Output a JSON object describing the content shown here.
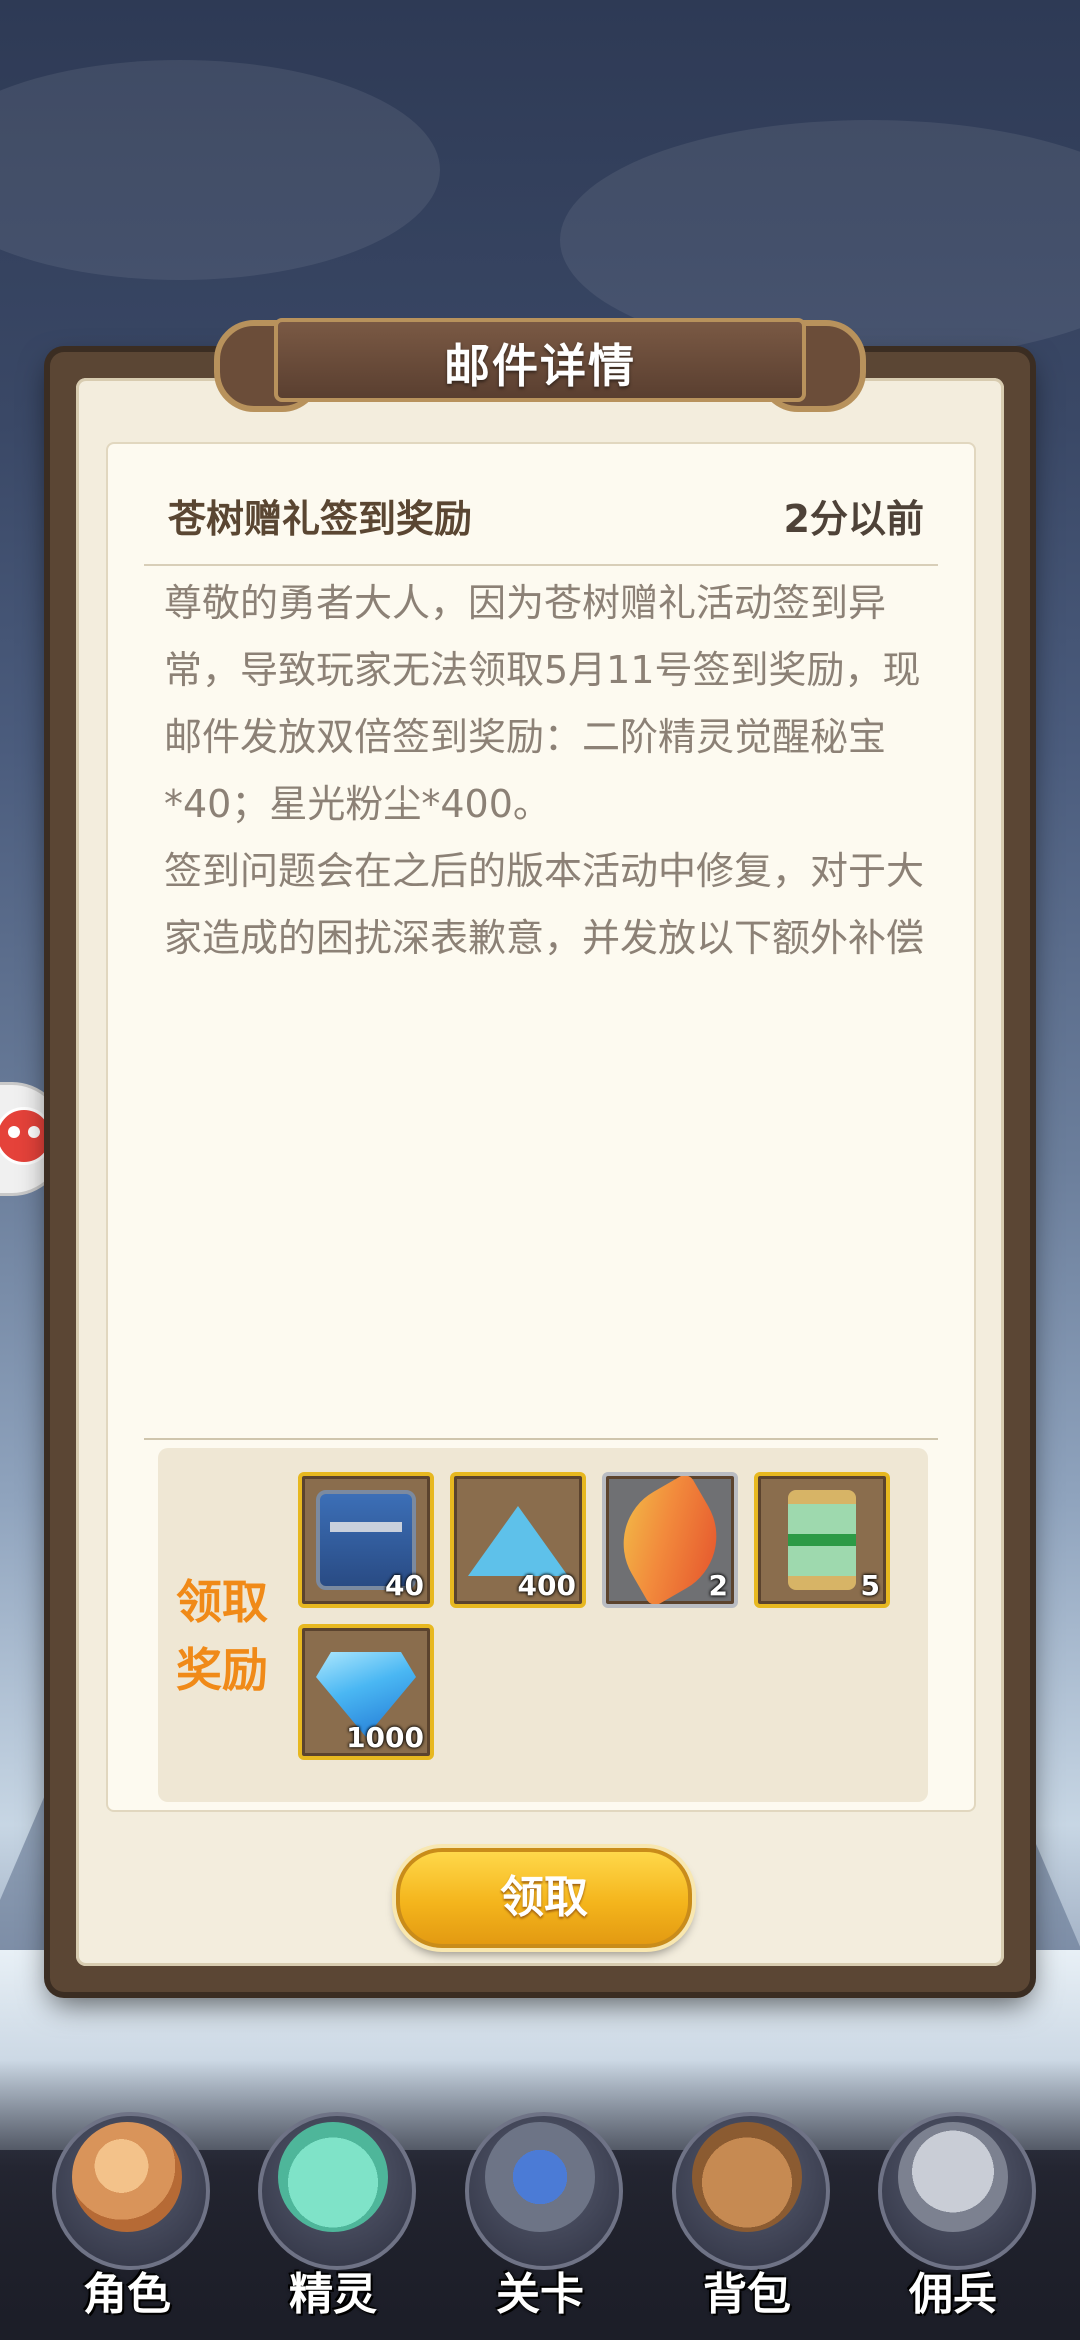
{
  "dialog": {
    "title": "邮件详情"
  },
  "mail": {
    "subject": "苍树赠礼签到奖励",
    "time": "2分以前",
    "body_paragraph_1": "尊敬的勇者大人，因为苍树赠礼活动签到异常，导致玩家无法领取5月11号签到奖励，现邮件发放双倍签到奖励：二阶精灵觉醒秘宝*40；星光粉尘*400。",
    "body_paragraph_2": "签到问题会在之后的版本活动中修复，对于大家造成的困扰深表歉意，并发放以下额外补偿"
  },
  "rewards": {
    "label": "领取奖励",
    "items": [
      {
        "icon": "treasure-chest-icon",
        "quantity": "40"
      },
      {
        "icon": "star-dust-icon",
        "quantity": "400"
      },
      {
        "icon": "feather-icon",
        "quantity": "2"
      },
      {
        "icon": "hourglass-icon",
        "quantity": "5"
      },
      {
        "icon": "diamond-icon",
        "quantity": "1000"
      }
    ]
  },
  "claim_button": {
    "label": "领取"
  },
  "nav": {
    "items": [
      {
        "label": "角色",
        "icon": "hero-icon"
      },
      {
        "label": "精灵",
        "icon": "spirit-icon"
      },
      {
        "label": "关卡",
        "icon": "stage-icon"
      },
      {
        "label": "背包",
        "icon": "backpack-icon"
      },
      {
        "label": "佣兵",
        "icon": "mercenary-icon"
      }
    ]
  },
  "colors": {
    "reward_label": "#f08a18",
    "item_border": "#e7b820",
    "button_gold": "#f4b51c",
    "panel_frame": "#5b4634"
  }
}
